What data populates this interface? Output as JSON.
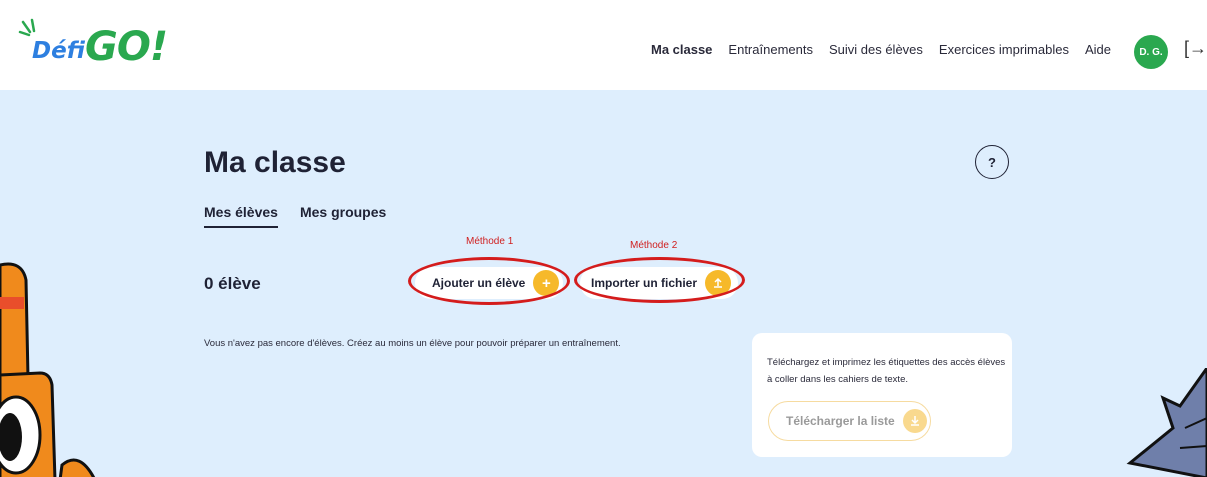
{
  "app": {
    "logo_defi": "Défi",
    "logo_go": "GO!"
  },
  "nav": {
    "items": [
      "Ma classe",
      "Entraînements",
      "Suivi des élèves",
      "Exercices imprimables",
      "Aide"
    ],
    "avatar": "D. G.",
    "logout_icon": "logout-icon"
  },
  "page": {
    "title": "Ma classe",
    "help": "?",
    "tabs": [
      "Mes élèves",
      "Mes groupes"
    ],
    "count": "0 élève",
    "method1": "Méthode 1",
    "method2": "Méthode 2",
    "add_button": "Ajouter un élève",
    "import_button": "Importer un fichier",
    "empty_text": "Vous n'avez pas encore d'élèves. Créez au moins un élève pour pouvoir préparer un entraînement.",
    "card_text": "Téléchargez et imprimez les étiquettes des accès élèves à coller dans les cahiers de texte.",
    "download_button": "Télécharger la liste"
  },
  "colors": {
    "accent_green": "#2aa84f",
    "accent_blue": "#2d7fe0",
    "button_yellow": "#f6b92a",
    "annotation_red": "#d41c1c",
    "background": "#deeefd"
  }
}
